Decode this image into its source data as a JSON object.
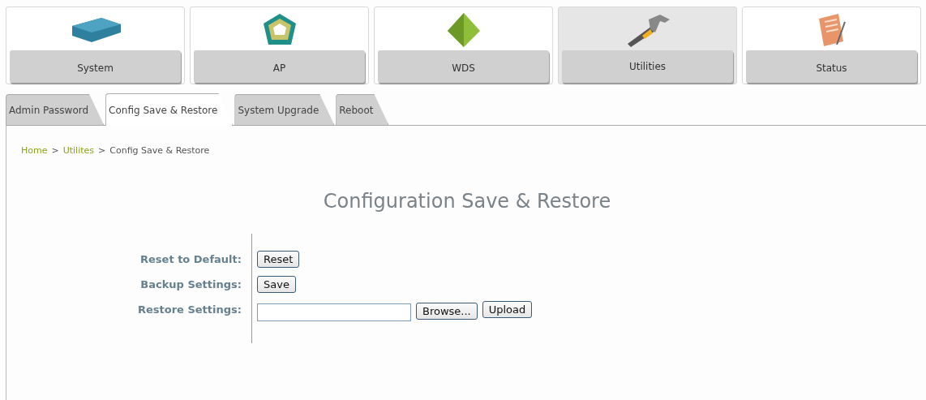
{
  "nav": [
    {
      "label": "System",
      "selected": false,
      "kind": "device"
    },
    {
      "label": "AP",
      "selected": false,
      "kind": "ap"
    },
    {
      "label": "WDS",
      "selected": false,
      "kind": "pyramid"
    },
    {
      "label": "Utilities",
      "selected": true,
      "kind": "hammer"
    },
    {
      "label": "Status",
      "selected": false,
      "kind": "notes"
    }
  ],
  "tabs": [
    {
      "label": "Admin Password",
      "selected": false
    },
    {
      "label": "Config Save & Restore",
      "selected": true
    },
    {
      "label": "System Upgrade",
      "selected": false
    },
    {
      "label": "Reboot",
      "selected": false
    }
  ],
  "breadcrumb": {
    "links": [
      "Home",
      "Utilites"
    ],
    "separator": ">",
    "current": "Config Save & Restore"
  },
  "title": "Configuration Save & Restore",
  "rows": [
    {
      "label": "Reset to Default:",
      "controls": [
        {
          "kind": "button",
          "label": "Reset"
        }
      ]
    },
    {
      "label": "Backup Settings:",
      "controls": [
        {
          "kind": "button",
          "label": "Save"
        }
      ]
    },
    {
      "label": "Restore Settings:",
      "controls": [
        {
          "kind": "file",
          "label": "Browse..."
        },
        {
          "kind": "button",
          "label": "Upload"
        }
      ]
    }
  ]
}
